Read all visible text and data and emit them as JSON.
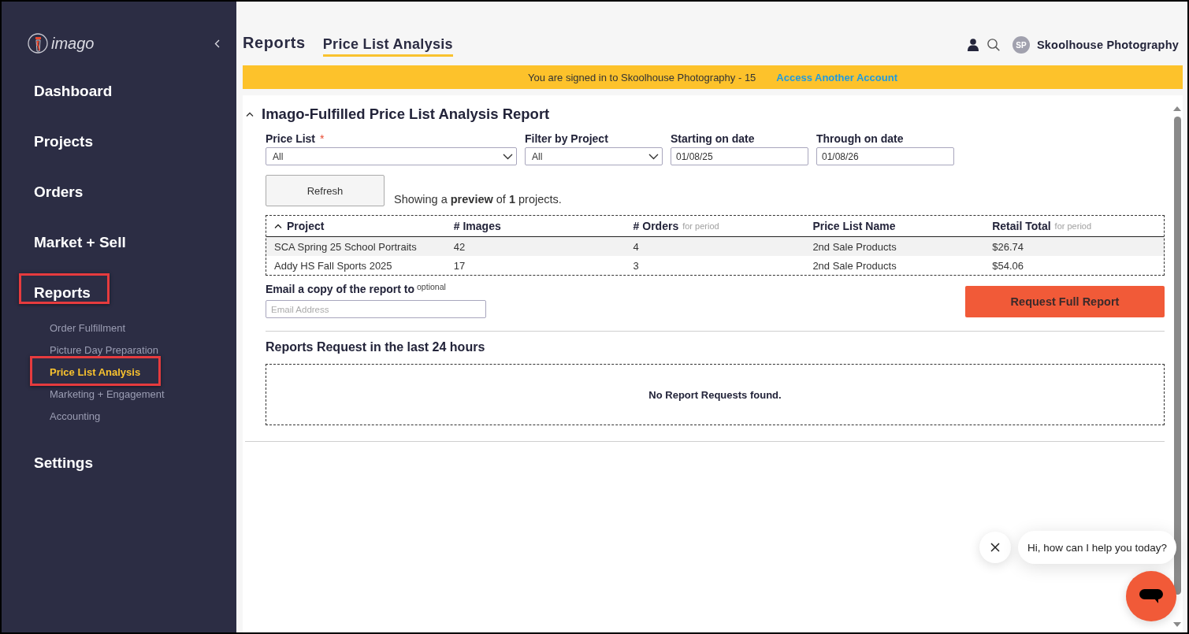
{
  "sidebar": {
    "logo": "imago",
    "items": [
      {
        "label": "Dashboard",
        "highlighted": false
      },
      {
        "label": "Projects",
        "highlighted": false
      },
      {
        "label": "Orders",
        "highlighted": false
      },
      {
        "label": "Market + Sell",
        "highlighted": false
      },
      {
        "label": "Reports",
        "highlighted": true,
        "children": [
          {
            "label": "Order Fulfillment",
            "selected": false,
            "highlighted": false
          },
          {
            "label": "Picture Day Preparation",
            "selected": false,
            "highlighted": false
          },
          {
            "label": "Price List Analysis",
            "selected": true,
            "highlighted": true
          },
          {
            "label": "Marketing + Engagement",
            "selected": false,
            "highlighted": false
          },
          {
            "label": "Accounting",
            "selected": false,
            "highlighted": false
          }
        ]
      },
      {
        "label": "Settings",
        "highlighted": false
      }
    ]
  },
  "header": {
    "tabs": [
      {
        "label": "Reports",
        "selected": false
      },
      {
        "label": "Price List Analysis",
        "selected": true
      }
    ],
    "avatar": "SP",
    "account_name": "Skoolhouse Photography"
  },
  "banner": {
    "message": "You are signed in to Skoolhouse Photography - 15",
    "link": "Access Another Account"
  },
  "report": {
    "title": "Imago-Fulfilled Price List Analysis Report",
    "expanded": true,
    "filters": [
      {
        "kind": "select",
        "label": "Price List",
        "required_mark": "*",
        "value": "All"
      },
      {
        "kind": "select",
        "label": "Filter by Project",
        "value": "All"
      },
      {
        "kind": "date",
        "label": "Starting on date",
        "value": "01/08/25"
      },
      {
        "kind": "date",
        "label": "Through on date",
        "value": "01/08/26"
      }
    ],
    "refresh_button": "Refresh",
    "preview_note": "Showing a **preview** of **1** projects.",
    "table": {
      "columns": [
        {
          "label": "Project",
          "sorted": true
        },
        {
          "label": "# Images",
          "sorted": false
        },
        {
          "label": "# Orders",
          "note": "for period",
          "sorted": false
        },
        {
          "label": "Price List Name",
          "sorted": false
        },
        {
          "label": "Retail Total",
          "note": "for period",
          "sorted": false
        }
      ],
      "rows": [
        [
          "SCA Spring 25 School Portraits",
          "42",
          "4",
          "2nd Sale Products",
          "$26.74"
        ],
        [
          "Addy HS Fall Sports 2025",
          "17",
          "3",
          "2nd Sale Products",
          "$54.06"
        ]
      ]
    },
    "email": {
      "label": "Email a copy of the report to",
      "note": "optional",
      "placeholder": "Email Address"
    },
    "request_button": "Request Full Report",
    "requests": {
      "title": "Reports Request in the last 24 hours",
      "empty_message": "No Report Requests found."
    }
  },
  "chat": {
    "message": "Hi, how can I help you today?"
  }
}
